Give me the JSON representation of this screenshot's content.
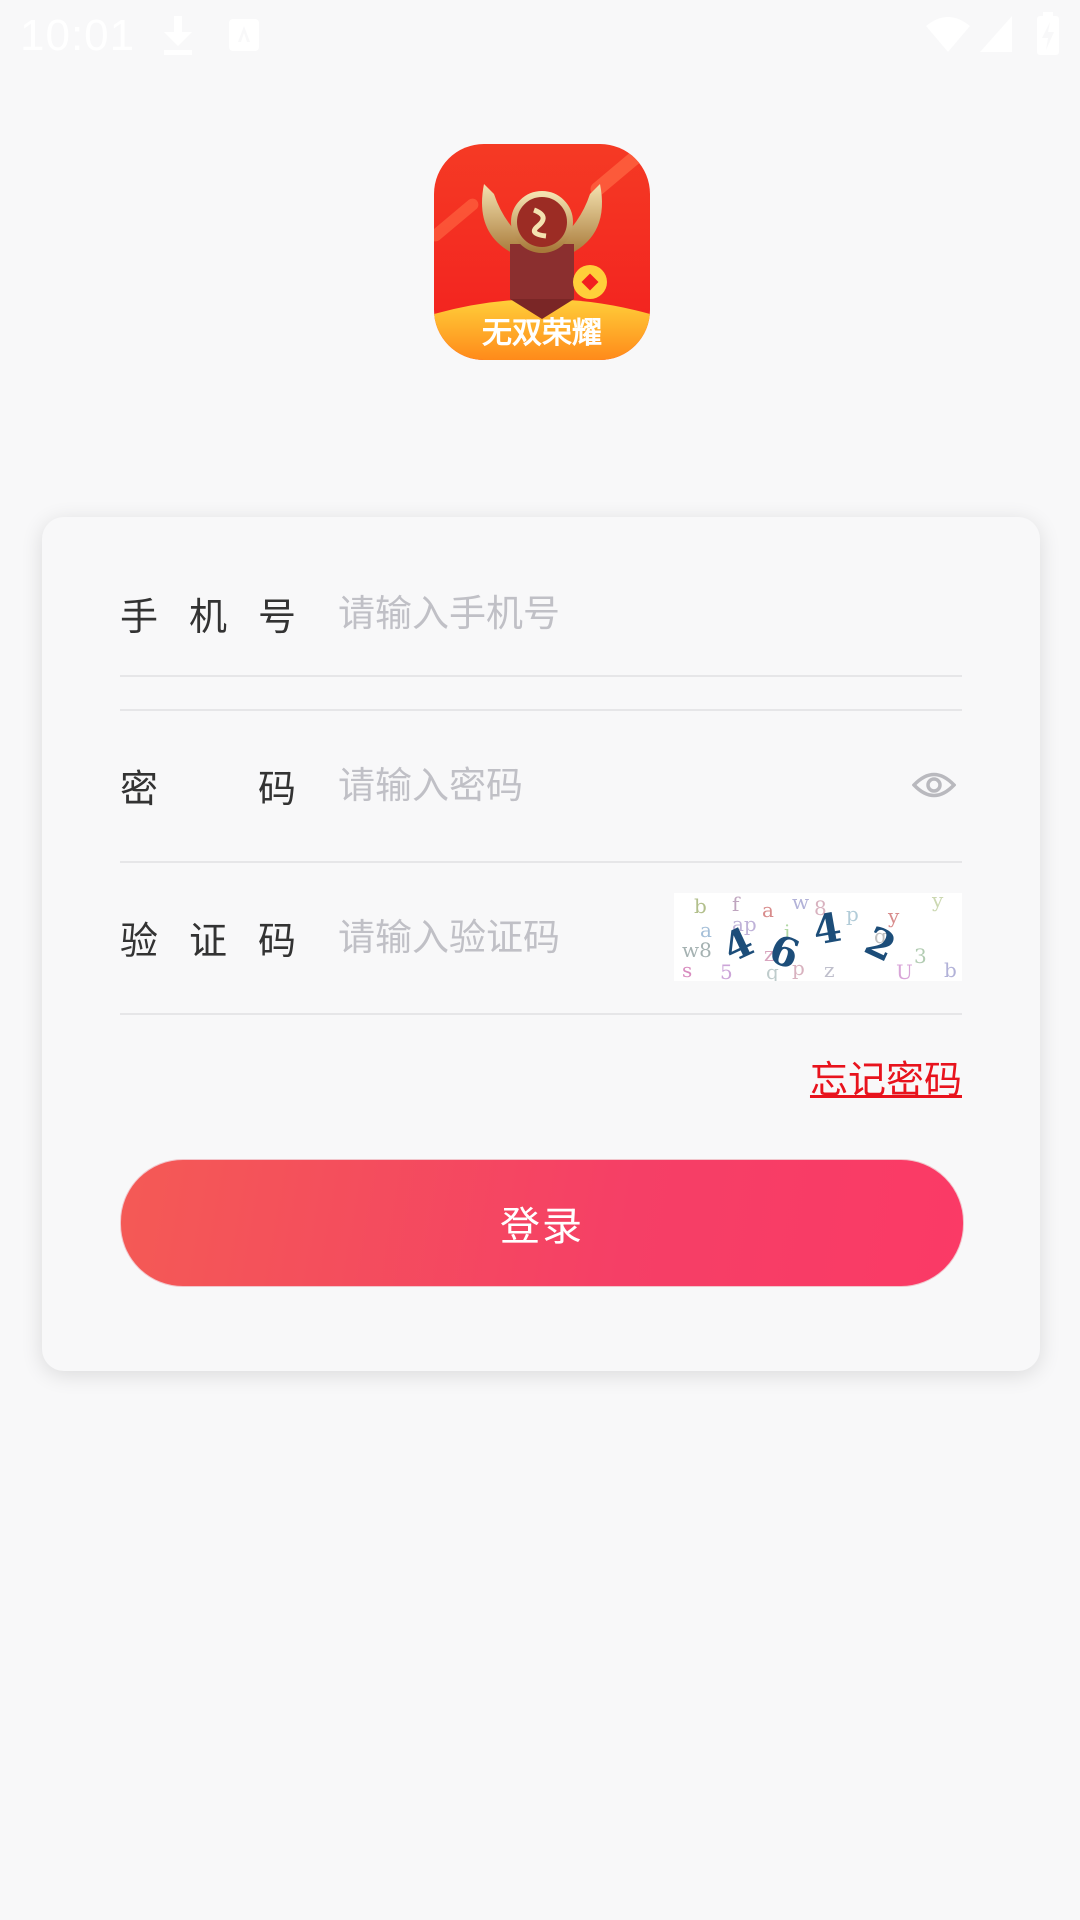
{
  "status_bar": {
    "time": "10:01",
    "icons": [
      "download-icon",
      "keyboard-icon",
      "wifi-icon",
      "signal-icon",
      "battery-charging-icon"
    ]
  },
  "app": {
    "logo_text": "无双荣耀",
    "brand_color": "#f5302a"
  },
  "form": {
    "phone": {
      "label_chars": [
        "手",
        "机",
        "号"
      ],
      "placeholder": "请输入手机号",
      "value": ""
    },
    "password": {
      "label_chars": [
        "密",
        "码"
      ],
      "placeholder": "请输入密码",
      "value": "",
      "toggle_icon": "eye-icon"
    },
    "captcha": {
      "label_chars": [
        "验",
        "证",
        "码"
      ],
      "placeholder": "请输入验证码",
      "value": "",
      "image_code": "4642"
    },
    "forgot_password": "忘记密码",
    "login_button": "登录"
  },
  "colors": {
    "accent": "#f5435f",
    "link": "#e8131d",
    "placeholder": "#c0c0c6",
    "label": "#333333"
  }
}
